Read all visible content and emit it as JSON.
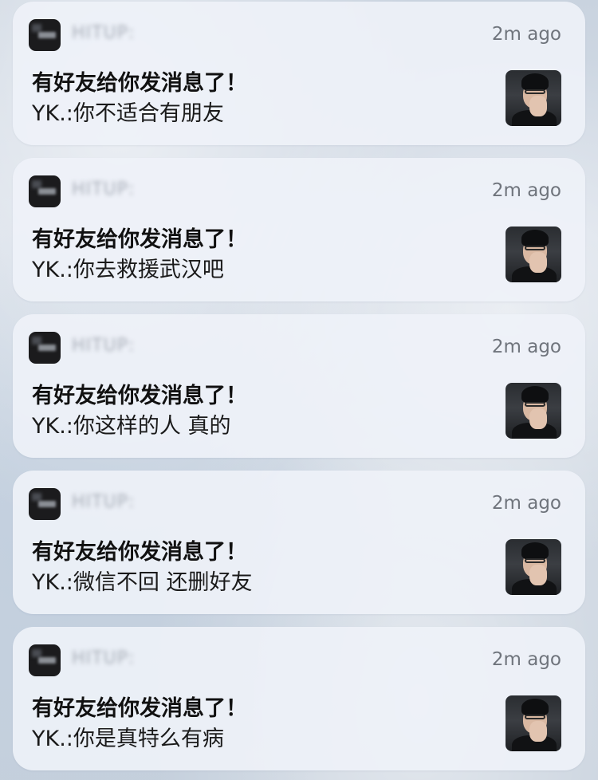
{
  "notifications": [
    {
      "app_name": "HITUP:",
      "time": "2m ago",
      "title": "有好友给你发消息了！",
      "body": "YK.:你不适合有朋友",
      "icon": "app-icon",
      "avatar": "sender-avatar"
    },
    {
      "app_name": "HITUP:",
      "time": "2m ago",
      "title": "有好友给你发消息了！",
      "body": "YK.:你去救援武汉吧",
      "icon": "app-icon",
      "avatar": "sender-avatar"
    },
    {
      "app_name": "HITUP:",
      "time": "2m ago",
      "title": "有好友给你发消息了！",
      "body": "YK.:你这样的人 真的",
      "icon": "app-icon",
      "avatar": "sender-avatar"
    },
    {
      "app_name": "HITUP:",
      "time": "2m ago",
      "title": "有好友给你发消息了！",
      "body": "YK.:微信不回 还删好友",
      "icon": "app-icon",
      "avatar": "sender-avatar"
    },
    {
      "app_name": "HITUP:",
      "time": "2m ago",
      "title": "有好友给你发消息了！",
      "body": "YK.:你是真特么有病",
      "icon": "app-icon",
      "avatar": "sender-avatar"
    }
  ]
}
